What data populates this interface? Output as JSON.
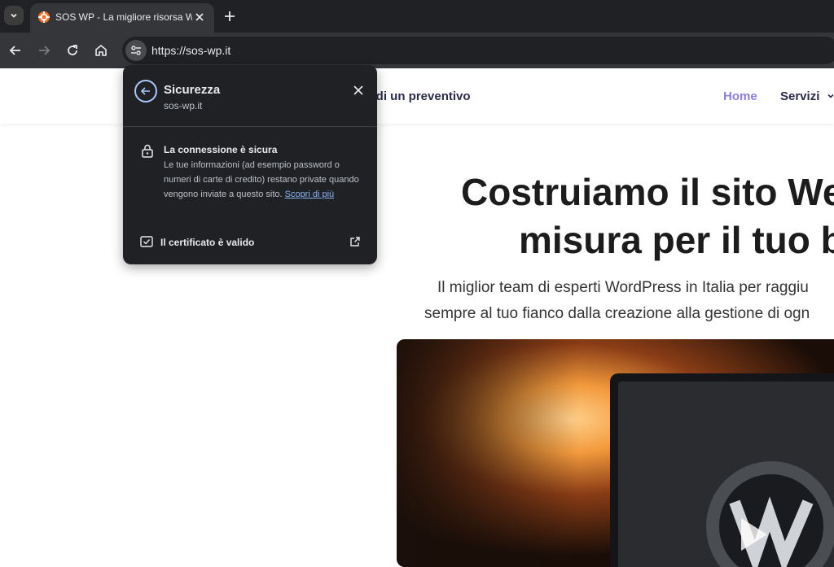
{
  "browser": {
    "tab": {
      "title": "SOS WP - La migliore risorsa W"
    },
    "omnibox": {
      "url": "https://sos-wp.it"
    }
  },
  "popup": {
    "title": "Sicurezza",
    "domain": "sos-wp.it",
    "connection_title": "La connessione è sicura",
    "connection_desc": "Le tue informazioni (ad esempio password o numeri di carte di credito) restano private quando vengono inviate a questo sito.",
    "learn_more": "Scopri di più",
    "certificate_label": "Il certificato è valido"
  },
  "page": {
    "cta": "hiedi un preventivo",
    "nav": {
      "home": "Home",
      "services": "Servizi"
    },
    "hero": {
      "title_line1": "Costruiamo il sito We",
      "title_line2": "misura per il tuo b",
      "subtitle_line1": "Il miglior team di esperti WordPress in Italia per raggiu",
      "subtitle_line2": "sempre al tuo fianco dalla creazione alla gestione di ogn"
    }
  },
  "colors": {
    "nav_active": "#8b7fe0",
    "link": "#8ab4f8",
    "popup_bg": "#202124"
  }
}
